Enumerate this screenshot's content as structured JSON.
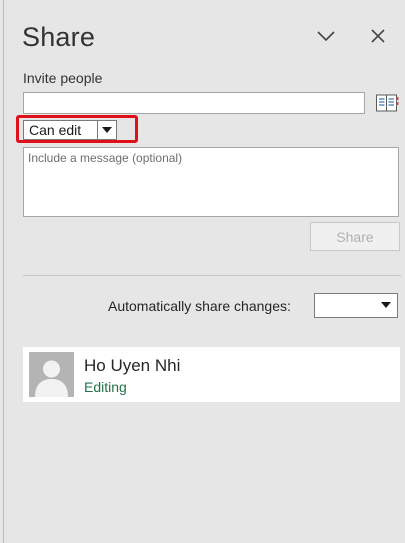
{
  "pane": {
    "title": "Share"
  },
  "icons": {
    "collapse": "chevron-down-icon",
    "close": "close-icon",
    "address_book": "address-book-icon",
    "dropdown": "dropdown-arrow-icon",
    "avatar": "person-silhouette-icon"
  },
  "invite": {
    "label": "Invite people",
    "value": "",
    "permission": "Can edit",
    "message_placeholder": "Include a message (optional)",
    "share_label": "Share"
  },
  "auto_share": {
    "label": "Automatically share changes:",
    "value": ""
  },
  "people": [
    {
      "name": "Ho Uyen Nhi",
      "status": "Editing"
    }
  ],
  "colors": {
    "highlight": "#e0101a",
    "status_green": "#217346",
    "pane_bg": "#e6e6e6"
  }
}
